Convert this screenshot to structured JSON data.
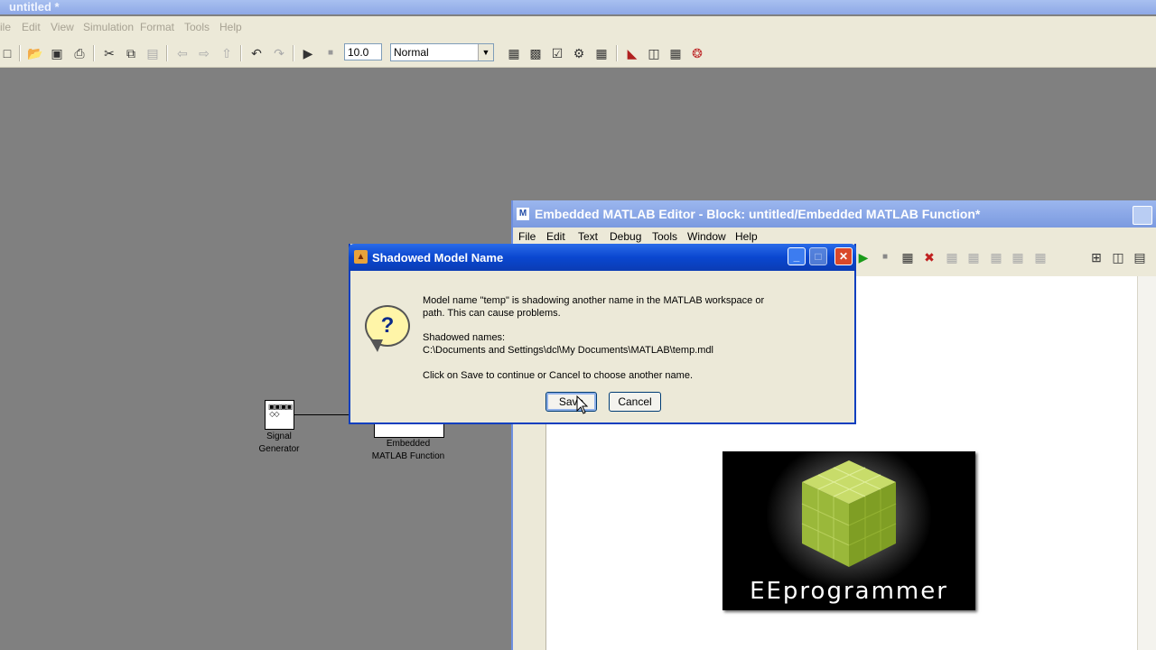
{
  "main_window": {
    "title": "untitled *",
    "menu": [
      "ile",
      "Edit",
      "View",
      "Simulation",
      "Format",
      "Tools",
      "Help"
    ],
    "toolbar": {
      "icons": [
        "new-icon",
        "open-icon",
        "save-icon",
        "print-icon",
        "cut-icon",
        "copy-icon",
        "paste-icon",
        "back-icon",
        "forward-icon",
        "up-icon",
        "undo-icon",
        "redo-icon",
        "play-icon",
        "stop-icon"
      ],
      "stop_time": "10.0",
      "sim_mode": "Normal",
      "right_icons": [
        "library-icon",
        "model-explorer-icon",
        "debug-icon",
        "build-icon",
        "update-icon",
        "signal-icon",
        "scope-icon",
        "target-icon",
        "settings-icon"
      ]
    }
  },
  "model": {
    "blocks": [
      {
        "label_line1": "Signal",
        "label_line2": "Generator"
      },
      {
        "label_line1": "Embedded",
        "label_line2": "MATLAB Function"
      }
    ]
  },
  "editor": {
    "title": "Embedded MATLAB Editor - Block: untitled/Embedded MATLAB Function*",
    "menu": [
      "File",
      "Edit",
      "Text",
      "Debug",
      "Tools",
      "Window",
      "Help"
    ]
  },
  "dialog": {
    "title": "Shadowed Model Name",
    "message_line1": "Model name \"temp\" is shadowing another name in the MATLAB workspace or",
    "message_line2": "path. This can cause problems.",
    "shadowed_label": "Shadowed names:",
    "shadowed_path": "C:\\Documents and Settings\\dcl\\My Documents\\MATLAB\\temp.mdl",
    "instruction": "Click on Save to continue or Cancel to choose another name.",
    "save_label": "Save",
    "cancel_label": "Cancel"
  },
  "watermark": {
    "text": "EEprogrammer"
  }
}
